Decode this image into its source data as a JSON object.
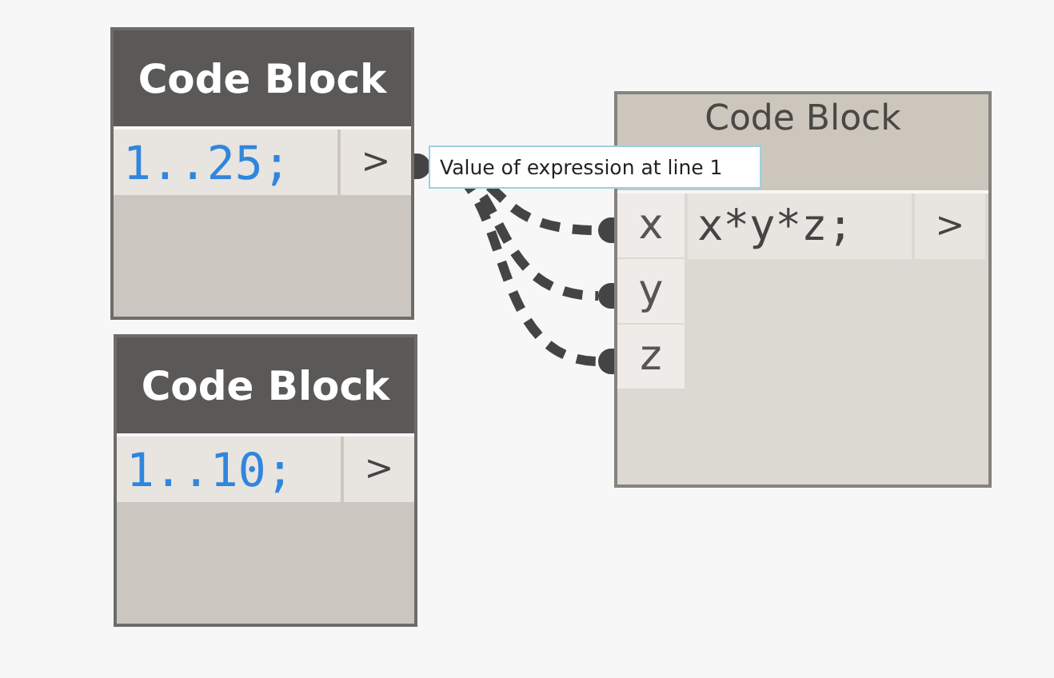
{
  "nodes": [
    {
      "title": "Code Block",
      "kind": "literal",
      "code": "1..25;",
      "output": ">",
      "output_connected": true
    },
    {
      "title": "Code Block",
      "kind": "literal",
      "code": "1..10;",
      "output": ">"
    },
    {
      "title": "Code Block",
      "kind": "formula",
      "code": "x*y*z;",
      "output": ">",
      "inputs": [
        {
          "name": "x",
          "connected": true
        },
        {
          "name": "y",
          "connected": true
        },
        {
          "name": "z",
          "connected": true
        }
      ]
    }
  ],
  "tooltip": {
    "text": "Value of expression at line 1"
  }
}
